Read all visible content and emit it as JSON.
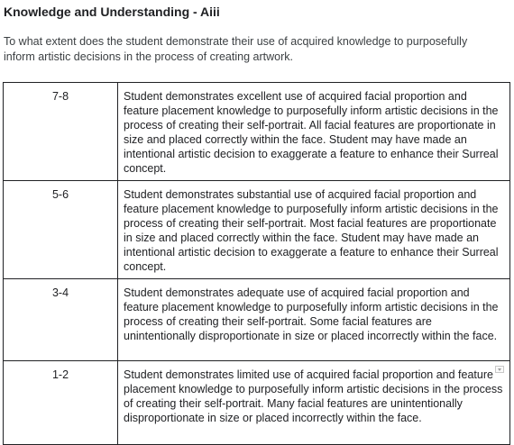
{
  "heading": "Knowledge and Understanding - Aiii",
  "question": "To what extent does the student demonstrate their use of acquired knowledge to purposefully inform artistic decisions in the process of creating artwork.",
  "rubric": [
    {
      "score": "7-8",
      "description": "Student demonstrates excellent use of acquired facial proportion and feature placement knowledge to purposefully inform artistic decisions in the process of creating their self-portrait. All facial features are proportionate in size and placed correctly within the face. Student may have made an intentional artistic decision to exaggerate a feature to enhance their Surreal concept."
    },
    {
      "score": "5-6",
      "description": "Student demonstrates substantial use of acquired facial proportion and feature placement knowledge to purposefully inform artistic decisions in the process of creating their self-portrait. Most facial features are proportionate in size and placed correctly within the face. Student may have made an intentional artistic decision to exaggerate a feature to enhance their Surreal concept."
    },
    {
      "score": "3-4",
      "description": "Student demonstrates adequate use of acquired facial proportion and feature placement knowledge to purposefully inform artistic decisions in the process of creating their self-portrait. Some facial features are unintentionally disproportionate in size or placed incorrectly within the face."
    },
    {
      "score": "1-2",
      "description": "Student demonstrates limited use of acquired facial proportion and feature placement knowledge to purposefully inform artistic decisions in the process of creating their self-portrait. Many facial features are unintentionally disproportionate in size or placed incorrectly within the face."
    }
  ]
}
